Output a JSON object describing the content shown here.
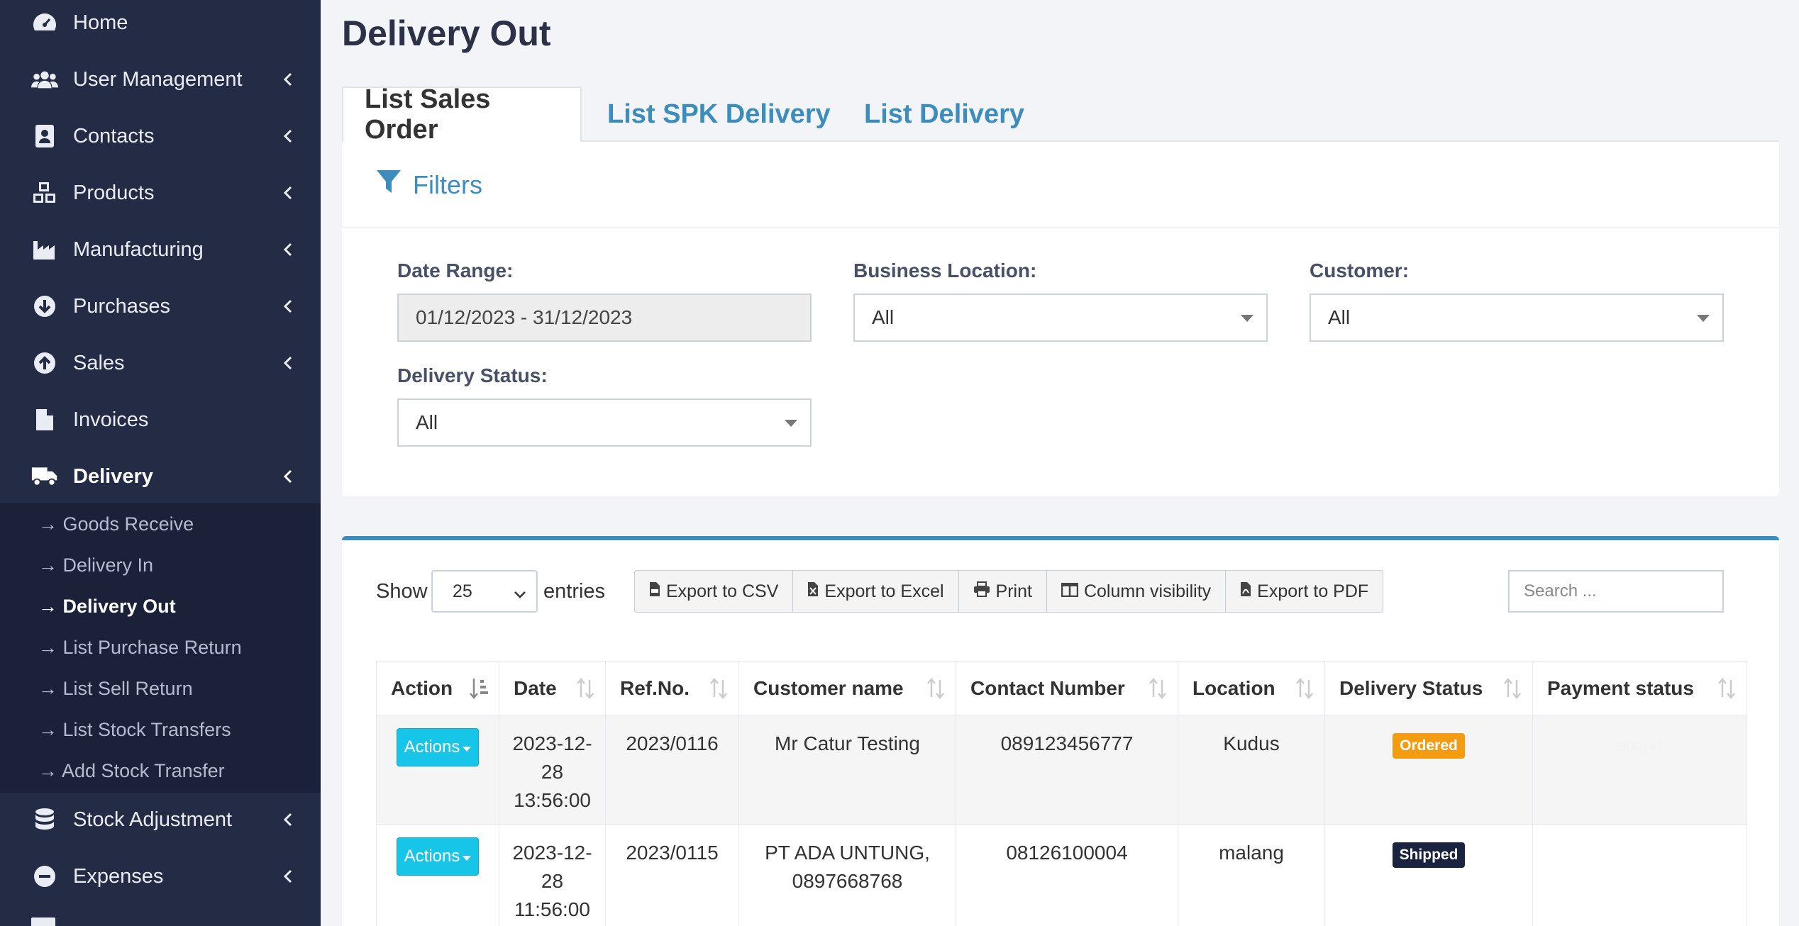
{
  "sidebar": {
    "items": [
      {
        "label": "Home"
      },
      {
        "label": "User Management"
      },
      {
        "label": "Contacts"
      },
      {
        "label": "Products"
      },
      {
        "label": "Manufacturing"
      },
      {
        "label": "Purchases"
      },
      {
        "label": "Sales"
      },
      {
        "label": "Invoices"
      },
      {
        "label": "Delivery"
      },
      {
        "label": "Stock Adjustment"
      },
      {
        "label": "Expenses"
      }
    ],
    "delivery_sub": [
      "→ Goods Receive",
      "→ Delivery In",
      "→ Delivery Out",
      "→ List Purchase Return",
      "→ List Sell Return",
      "→ List Stock Transfers",
      "→ Add Stock Transfer"
    ]
  },
  "page": {
    "title": "Delivery Out"
  },
  "tabs": [
    "List Sales Order",
    "List SPK Delivery",
    "List Delivery"
  ],
  "filters": {
    "heading": "Filters",
    "date_range_label": "Date Range:",
    "date_range_value": "01/12/2023 - 31/12/2023",
    "business_location_label": "Business Location:",
    "business_location_value": "All",
    "customer_label": "Customer:",
    "customer_value": "All",
    "delivery_status_label": "Delivery Status:",
    "delivery_status_value": "All"
  },
  "table_controls": {
    "show_label": "Show",
    "entries_value": "25",
    "entries_label": "entries",
    "buttons": [
      "Export to CSV",
      "Export to Excel",
      "Print",
      "Column visibility",
      "Export to PDF"
    ],
    "search_placeholder": "Search ..."
  },
  "table": {
    "columns": [
      "Action",
      "Date",
      "Ref.No.",
      "Customer name",
      "Contact Number",
      "Location",
      "Delivery Status",
      "Payment status"
    ],
    "rows": [
      {
        "action": "Actions",
        "date_1": "2023-12-",
        "date_2": "28",
        "date_3": "13:56:00",
        "ref": "2023/0116",
        "customer_1": "Mr Catur Testing",
        "customer_2": "",
        "contact": "089123456777",
        "location": "Kudus",
        "status": "Ordered",
        "payment": "lang_v1"
      },
      {
        "action": "Actions",
        "date_1": "2023-12-",
        "date_2": "28",
        "date_3": "11:56:00",
        "ref": "2023/0115",
        "customer_1": "PT ADA UNTUNG,",
        "customer_2": "0897668768",
        "contact": "08126100004",
        "location": "malang",
        "status": "Shipped",
        "payment": ""
      }
    ]
  },
  "colors": {
    "sidebar_bg": "#242b45",
    "submenu_bg": "#1b2138",
    "accent": "#3c8dbc",
    "actions_button": "#17c5e8",
    "ordered_badge": "#f39c12",
    "shipped_badge": "#1a2340"
  }
}
